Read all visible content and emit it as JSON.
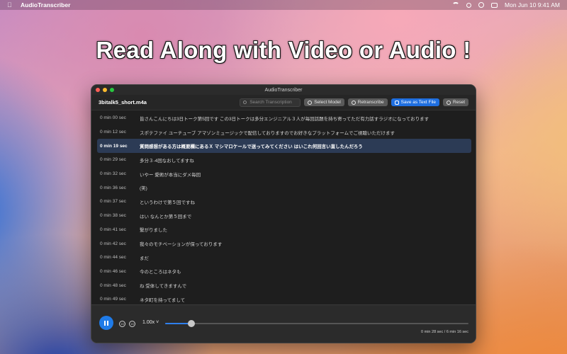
{
  "menubar": {
    "app_name": "AudioTranscriber",
    "clock": "Mon Jun 10  9:41 AM"
  },
  "headline": "Read Along with Video or Audio !",
  "window": {
    "title": "AudioTranscriber",
    "filename": "3bitalk5_short.m4a",
    "search_placeholder": "Search Transcription",
    "buttons": {
      "select_model": "Select Model",
      "retranscribe": "Retranscribe",
      "save_text": "Save as Text File",
      "reset": "Reset"
    }
  },
  "transcript": [
    {
      "time": "0 min 00 sec",
      "text": "皆さんこんにちは3日トーク第5回です この3日トークは多分エンジニアル３人が毎回話題を持ち寄ってただ有力話すラジオになっております"
    },
    {
      "time": "0 min 12 sec",
      "text": "スポテファイ ユーチューブ アマゾンミュージックで配信しておりますのでお好きなプラットフォームでご視聴いただけます"
    },
    {
      "time": "0 min 19 sec",
      "text": "質問感想がある方は概要欄にあるＸ マシマロケールで送ってみてください はいこれ何回言い直したんだろう",
      "active": true
    },
    {
      "time": "0 min 29 sec",
      "text": "多分３-4回なおしてますね"
    },
    {
      "time": "0 min 32 sec",
      "text": "いやー 愛術が本当にダメ毎回"
    },
    {
      "time": "0 min 36 sec",
      "text": "(笑)"
    },
    {
      "time": "0 min 37 sec",
      "text": "というわけで第５回ですね"
    },
    {
      "time": "0 min 38 sec",
      "text": "はい なんとか第５回まで"
    },
    {
      "time": "0 min 41 sec",
      "text": "繋がりました"
    },
    {
      "time": "0 min 42 sec",
      "text": "我々のモチベーションが保っております"
    },
    {
      "time": "0 min 44 sec",
      "text": "まだ"
    },
    {
      "time": "0 min 46 sec",
      "text": "今のところはネタも"
    },
    {
      "time": "0 min 48 sec",
      "text": "ね 受体してきますんで"
    },
    {
      "time": "0 min 49 sec",
      "text": "ネタ町を持ってまして"
    }
  ],
  "player": {
    "rate": "1.00x",
    "skip_back": "15",
    "skip_fwd": "15",
    "progress": 0.086,
    "time_label": "0 min 28 sec / 6 min 16 sec"
  }
}
